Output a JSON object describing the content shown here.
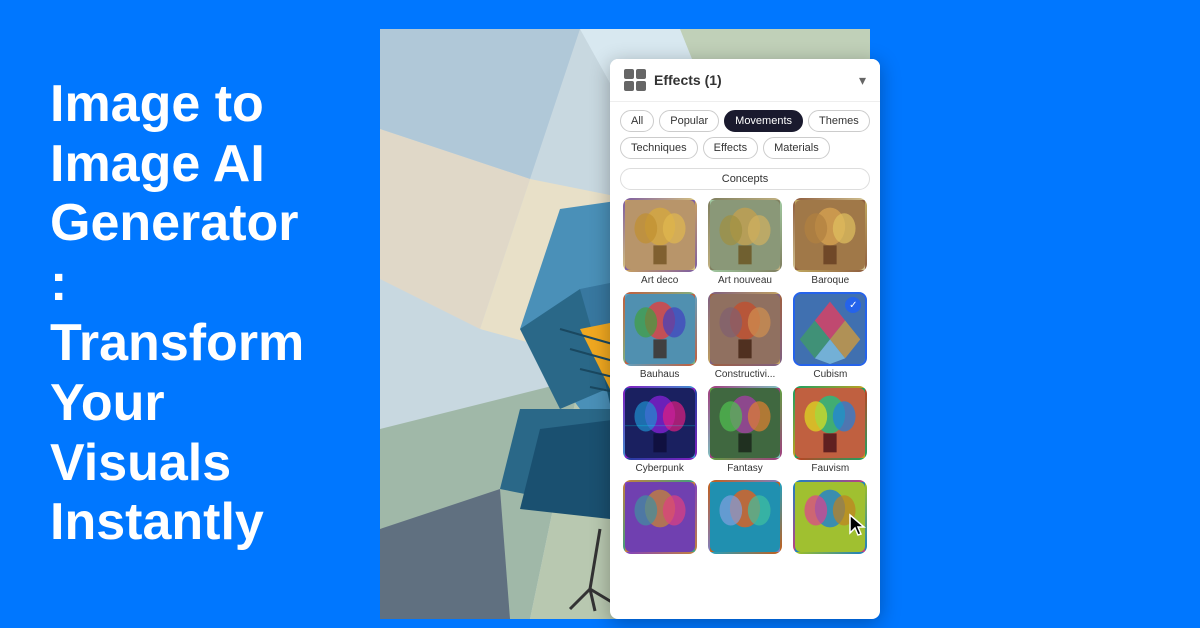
{
  "page": {
    "background_color": "#0077ff"
  },
  "hero": {
    "title": "Image to Image AI Generator : Transform Your Visuals Instantly"
  },
  "panel": {
    "title": "Effects (1)",
    "chevron": "▾",
    "filter_rows": [
      [
        "All",
        "Popular",
        "Movements",
        "Themes"
      ],
      [
        "Techniques",
        "Effects",
        "Materials"
      ]
    ],
    "active_filter": "Movements",
    "concepts_label": "Concepts",
    "grid_items": [
      {
        "id": "art-deco",
        "label": "Art deco",
        "style": "balloon-art-deco",
        "selected": false
      },
      {
        "id": "art-nouveau",
        "label": "Art nouveau",
        "style": "balloon-art-nouveau",
        "selected": false
      },
      {
        "id": "baroque",
        "label": "Baroque",
        "style": "balloon-baroque",
        "selected": false
      },
      {
        "id": "bauhaus",
        "label": "Bauhaus",
        "style": "balloon-bauhaus",
        "selected": false
      },
      {
        "id": "constructivi",
        "label": "Constructivi...",
        "style": "balloon-constructi",
        "selected": false
      },
      {
        "id": "cubism",
        "label": "Cubism",
        "style": "balloon-cubism",
        "selected": true
      },
      {
        "id": "cyberpunk",
        "label": "Cyberpunk",
        "style": "balloon-cyberpunk",
        "selected": false
      },
      {
        "id": "fantasy",
        "label": "Fantasy",
        "style": "balloon-fantasy",
        "selected": false
      },
      {
        "id": "fauvism",
        "label": "Fauvism",
        "style": "balloon-fauvism",
        "selected": false
      },
      {
        "id": "partial1",
        "label": "",
        "style": "balloon-partial1",
        "selected": false
      },
      {
        "id": "partial2",
        "label": "",
        "style": "balloon-partial2",
        "selected": false
      },
      {
        "id": "partial3",
        "label": "",
        "style": "balloon-partial3",
        "selected": false
      }
    ]
  }
}
